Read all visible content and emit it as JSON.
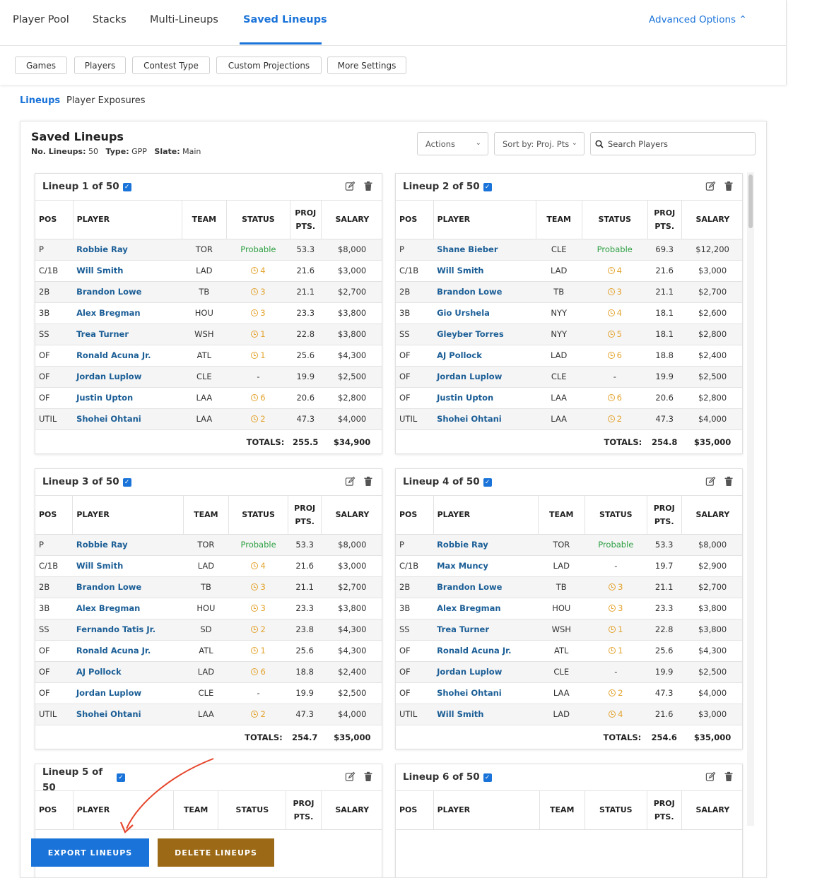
{
  "nav": {
    "tabs": [
      {
        "label": "Player Pool"
      },
      {
        "label": "Stacks"
      },
      {
        "label": "Multi-Lineups"
      },
      {
        "label": "Saved Lineups",
        "active": true
      }
    ],
    "advanced": "Advanced Options"
  },
  "filters": [
    "Games",
    "Players",
    "Contest Type",
    "Custom Projections",
    "More Settings"
  ],
  "subtabs": [
    "Lineups",
    "Player Exposures"
  ],
  "panel": {
    "title": "Saved Lineups",
    "meta": {
      "lineups_label": "No. Lineups:",
      "lineups": "50",
      "type_label": "Type:",
      "type": "GPP",
      "slate_label": "Slate:",
      "slate": "Main"
    },
    "actions": "Actions",
    "sort": "Sort by: Proj. Pts",
    "search_placeholder": "Search Players"
  },
  "headers": {
    "pos": "POS",
    "player": "PLAYER",
    "team": "TEAM",
    "status": "STATUS",
    "proj_1": "PROJ",
    "proj_2": "PTS.",
    "salary": "SALARY",
    "totals": "TOTALS:"
  },
  "colors": {
    "accent": "#1a73d9",
    "probable": "#2ea043",
    "status_warn": "#e3a32d",
    "export": "#1a73d9",
    "delete": "#9c6a16",
    "arrow": "#e5452b"
  },
  "lineups": [
    {
      "title": "Lineup 1 of 50",
      "total_pts": "255.5",
      "total_salary": "$34,900",
      "rows": [
        [
          "P",
          "Robbie Ray",
          "TOR",
          "Probable",
          "53.3",
          "$8,000"
        ],
        [
          "C/1B",
          "Will Smith",
          "LAD",
          "4",
          "21.6",
          "$3,000"
        ],
        [
          "2B",
          "Brandon Lowe",
          "TB",
          "3",
          "21.1",
          "$2,700"
        ],
        [
          "3B",
          "Alex Bregman",
          "HOU",
          "3",
          "23.3",
          "$3,800"
        ],
        [
          "SS",
          "Trea Turner",
          "WSH",
          "1",
          "22.8",
          "$3,800"
        ],
        [
          "OF",
          "Ronald Acuna Jr.",
          "ATL",
          "1",
          "25.6",
          "$4,300"
        ],
        [
          "OF",
          "Jordan Luplow",
          "CLE",
          "-",
          "19.9",
          "$2,500"
        ],
        [
          "OF",
          "Justin Upton",
          "LAA",
          "6",
          "20.6",
          "$2,800"
        ],
        [
          "UTIL",
          "Shohei Ohtani",
          "LAA",
          "2",
          "47.3",
          "$4,000"
        ]
      ]
    },
    {
      "title": "Lineup 2 of 50",
      "total_pts": "254.8",
      "total_salary": "$35,000",
      "rows": [
        [
          "P",
          "Shane Bieber",
          "CLE",
          "Probable",
          "69.3",
          "$12,200"
        ],
        [
          "C/1B",
          "Will Smith",
          "LAD",
          "4",
          "21.6",
          "$3,000"
        ],
        [
          "2B",
          "Brandon Lowe",
          "TB",
          "3",
          "21.1",
          "$2,700"
        ],
        [
          "3B",
          "Gio Urshela",
          "NYY",
          "4",
          "18.1",
          "$2,600"
        ],
        [
          "SS",
          "Gleyber Torres",
          "NYY",
          "5",
          "18.1",
          "$2,800"
        ],
        [
          "OF",
          "AJ Pollock",
          "LAD",
          "6",
          "18.8",
          "$2,400"
        ],
        [
          "OF",
          "Jordan Luplow",
          "CLE",
          "-",
          "19.9",
          "$2,500"
        ],
        [
          "OF",
          "Justin Upton",
          "LAA",
          "6",
          "20.6",
          "$2,800"
        ],
        [
          "UTIL",
          "Shohei Ohtani",
          "LAA",
          "2",
          "47.3",
          "$4,000"
        ]
      ]
    },
    {
      "title": "Lineup 3 of 50",
      "total_pts": "254.7",
      "total_salary": "$35,000",
      "rows": [
        [
          "P",
          "Robbie Ray",
          "TOR",
          "Probable",
          "53.3",
          "$8,000"
        ],
        [
          "C/1B",
          "Will Smith",
          "LAD",
          "4",
          "21.6",
          "$3,000"
        ],
        [
          "2B",
          "Brandon Lowe",
          "TB",
          "3",
          "21.1",
          "$2,700"
        ],
        [
          "3B",
          "Alex Bregman",
          "HOU",
          "3",
          "23.3",
          "$3,800"
        ],
        [
          "SS",
          "Fernando Tatis Jr.",
          "SD",
          "2",
          "23.8",
          "$4,300"
        ],
        [
          "OF",
          "Ronald Acuna Jr.",
          "ATL",
          "1",
          "25.6",
          "$4,300"
        ],
        [
          "OF",
          "AJ Pollock",
          "LAD",
          "6",
          "18.8",
          "$2,400"
        ],
        [
          "OF",
          "Jordan Luplow",
          "CLE",
          "-",
          "19.9",
          "$2,500"
        ],
        [
          "UTIL",
          "Shohei Ohtani",
          "LAA",
          "2",
          "47.3",
          "$4,000"
        ]
      ]
    },
    {
      "title": "Lineup 4 of 50",
      "total_pts": "254.6",
      "total_salary": "$35,000",
      "rows": [
        [
          "P",
          "Robbie Ray",
          "TOR",
          "Probable",
          "53.3",
          "$8,000"
        ],
        [
          "C/1B",
          "Max Muncy",
          "LAD",
          "-",
          "19.7",
          "$2,900"
        ],
        [
          "2B",
          "Brandon Lowe",
          "TB",
          "3",
          "21.1",
          "$2,700"
        ],
        [
          "3B",
          "Alex Bregman",
          "HOU",
          "3",
          "23.3",
          "$3,800"
        ],
        [
          "SS",
          "Trea Turner",
          "WSH",
          "1",
          "22.8",
          "$3,800"
        ],
        [
          "OF",
          "Ronald Acuna Jr.",
          "ATL",
          "1",
          "25.6",
          "$4,300"
        ],
        [
          "OF",
          "Jordan Luplow",
          "CLE",
          "-",
          "19.9",
          "$2,500"
        ],
        [
          "OF",
          "Shohei Ohtani",
          "LAA",
          "2",
          "47.3",
          "$4,000"
        ],
        [
          "UTIL",
          "Will Smith",
          "LAD",
          "4",
          "21.6",
          "$3,000"
        ]
      ]
    },
    {
      "title": "Lineup 5 of 50",
      "total_pts": "",
      "total_salary": "",
      "rows": []
    },
    {
      "title": "Lineup 6 of 50",
      "total_pts": "",
      "total_salary": "",
      "rows": []
    }
  ],
  "buttons": {
    "export": "EXPORT LINEUPS",
    "delete": "DELETE LINEUPS"
  }
}
